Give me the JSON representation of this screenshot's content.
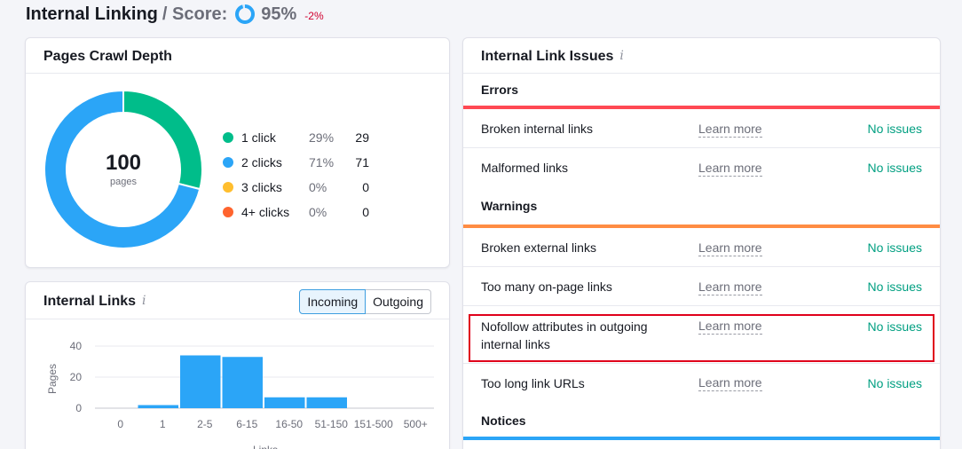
{
  "header": {
    "title": "Internal Linking",
    "separator": "/ Score:",
    "score": "95%",
    "delta": "-2%",
    "score_value": 0.95,
    "score_color": "#2ba5f7"
  },
  "crawl_depth": {
    "title": "Pages Crawl Depth",
    "total": "100",
    "total_label": "pages",
    "legend": [
      {
        "label": "1 click",
        "pct": "29%",
        "count": "29",
        "color": "#00bd8a"
      },
      {
        "label": "2 clicks",
        "pct": "71%",
        "count": "71",
        "color": "#2ba5f7"
      },
      {
        "label": "3 clicks",
        "pct": "0%",
        "count": "0",
        "color": "#ffbe2e"
      },
      {
        "label": "4+ clicks",
        "pct": "0%",
        "count": "0",
        "color": "#ff642e"
      }
    ]
  },
  "internal_links": {
    "title": "Internal Links",
    "info_icon": "info-icon",
    "toggle": {
      "incoming": "Incoming",
      "outgoing": "Outgoing",
      "selected": "Incoming"
    }
  },
  "chart_data": {
    "type": "bar",
    "categories": [
      "0",
      "1",
      "2-5",
      "6-15",
      "16-50",
      "51-150",
      "151-500",
      "500+"
    ],
    "values": [
      0,
      2,
      34,
      33,
      7,
      7,
      0,
      0
    ],
    "ylabel": "Pages",
    "xlabel": "Links",
    "yticks": [
      0,
      20,
      40
    ],
    "ylim": [
      0,
      40
    ],
    "color": "#2ba5f7",
    "grid": true
  },
  "issues": {
    "title": "Internal Link Issues",
    "learn_more": "Learn more",
    "sections": [
      {
        "name": "Errors",
        "color": "#ff4953",
        "rows": [
          {
            "name": "Broken internal links",
            "status": "No issues"
          },
          {
            "name": "Malformed links",
            "status": "No issues"
          }
        ]
      },
      {
        "name": "Warnings",
        "color": "#ff8c43",
        "rows": [
          {
            "name": "Broken external links",
            "status": "No issues"
          },
          {
            "name": "Too many on-page links",
            "status": "No issues"
          },
          {
            "name": "Nofollow attributes in outgoing internal links",
            "status": "No issues"
          },
          {
            "name": "Too long link URLs",
            "status": "No issues"
          }
        ]
      },
      {
        "name": "Notices",
        "color": "#2ba5f7",
        "rows": []
      }
    ]
  }
}
